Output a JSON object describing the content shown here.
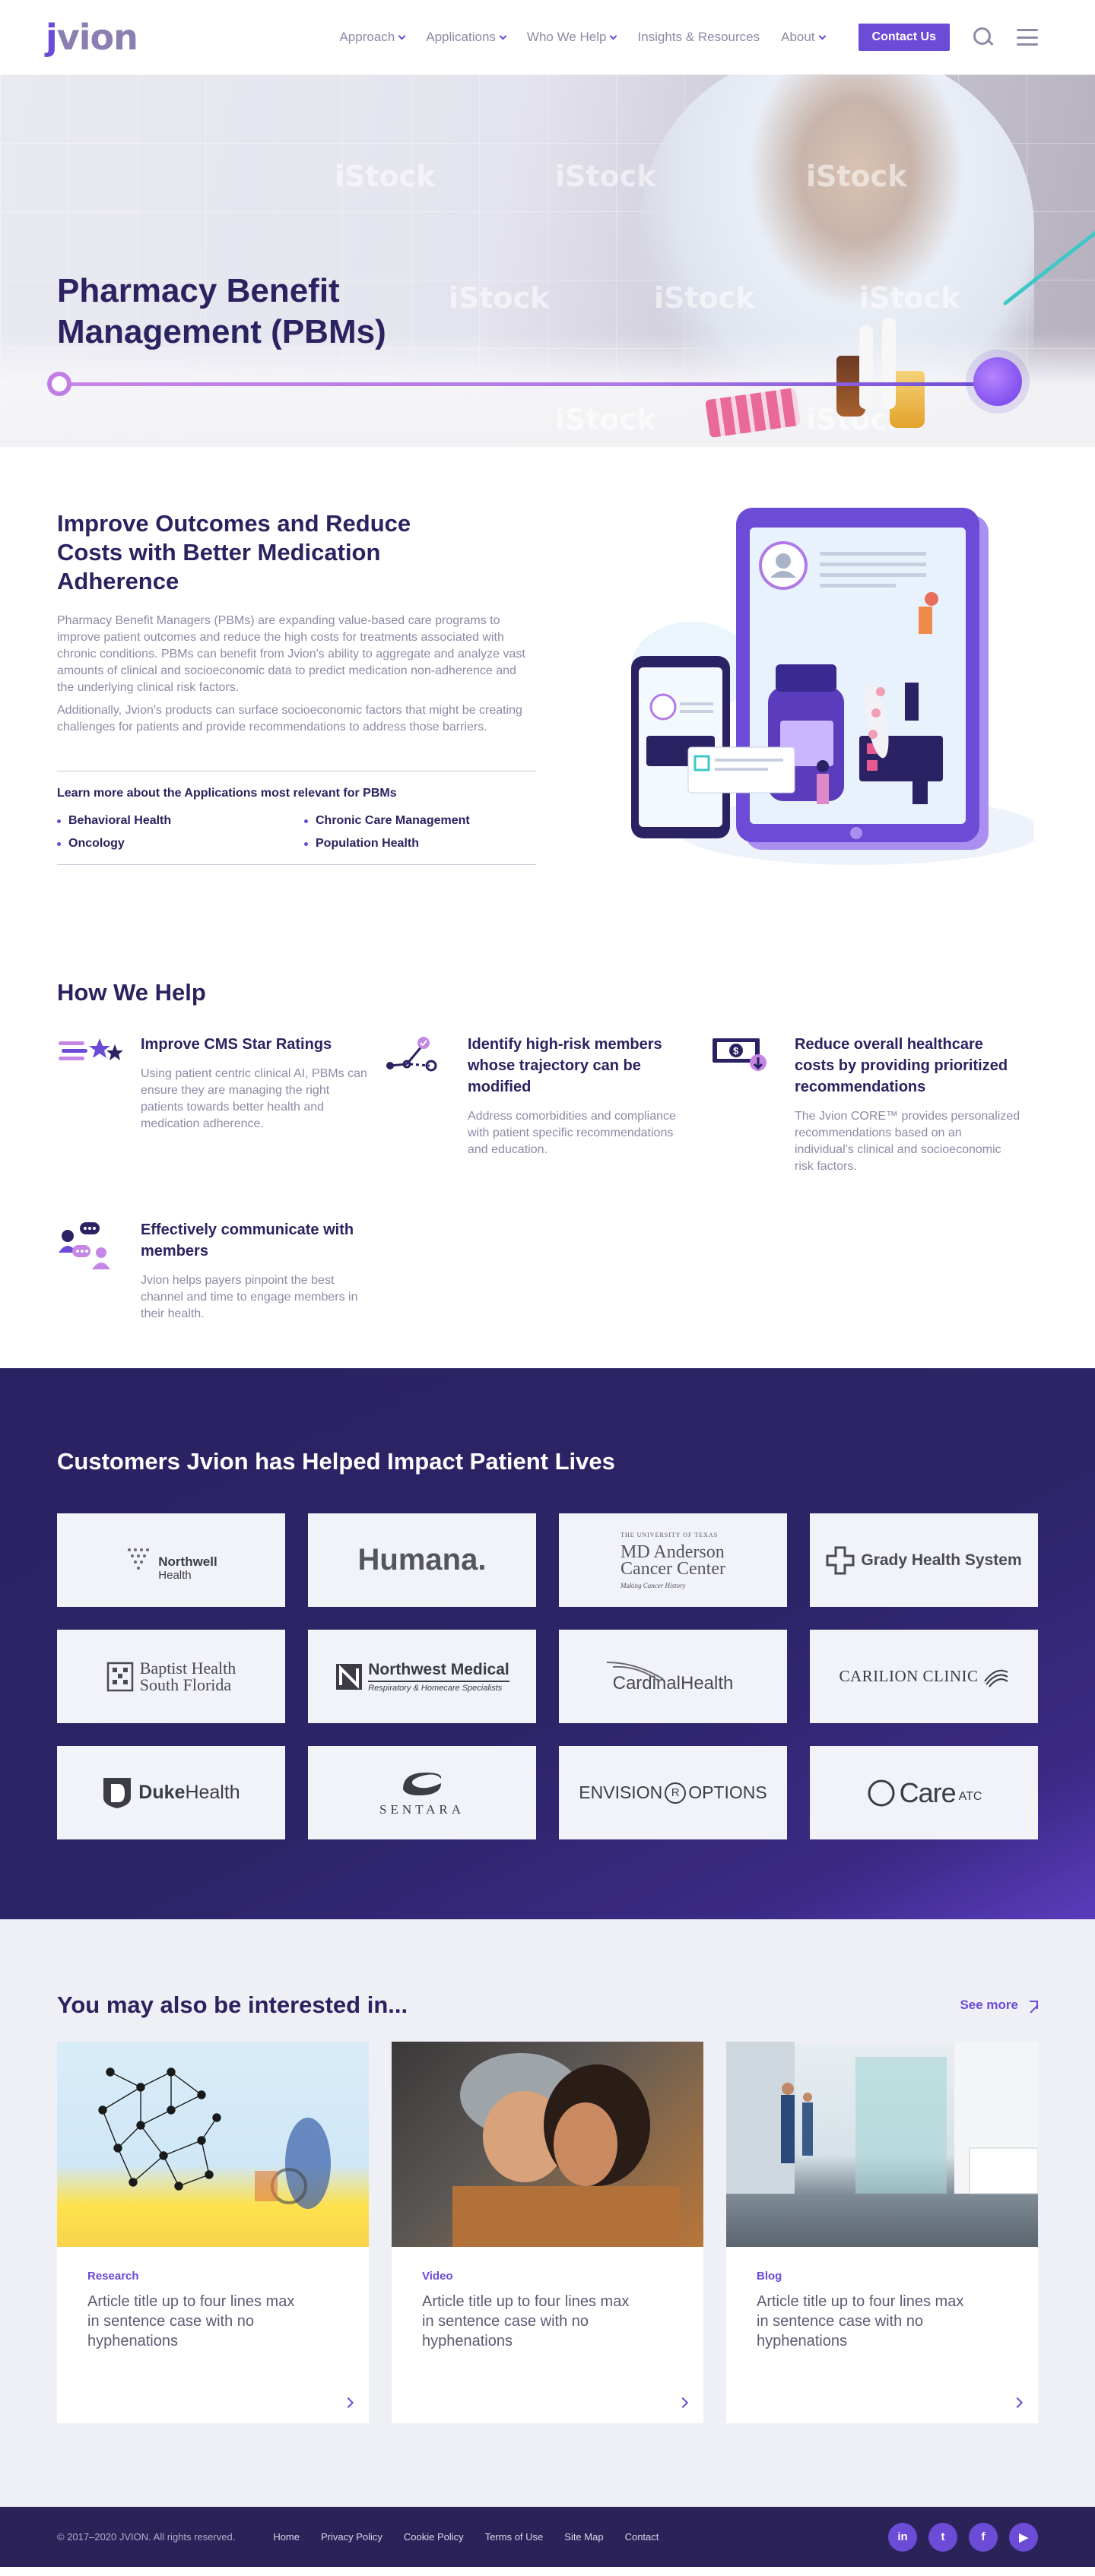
{
  "header": {
    "logo_prefix": "j",
    "logo_rest": "vion",
    "nav": [
      {
        "label": "Approach",
        "has_dropdown": true
      },
      {
        "label": "Applications",
        "has_dropdown": true
      },
      {
        "label": "Who We Help",
        "has_dropdown": true
      },
      {
        "label": "Insights & Resources",
        "has_dropdown": false
      },
      {
        "label": "About",
        "has_dropdown": true
      }
    ],
    "contact_label": "Contact Us",
    "icons": [
      "search-icon",
      "menu-icon"
    ]
  },
  "hero": {
    "title_line1": "Pharmacy Benefit",
    "title_line2": "Management (PBMs)",
    "watermark": "iStock"
  },
  "intro": {
    "title": "Improve Outcomes and Reduce Costs with Better Medication Adherence",
    "paragraph1": "Pharmacy Benefit Managers (PBMs) are expanding value-based care programs to improve patient outcomes and reduce the high costs for treatments associated with chronic conditions. PBMs can benefit from Jvion's ability to aggregate and analyze vast amounts of clinical and socioeconomic data to predict medication non-adherence and the underlying clinical risk factors.",
    "paragraph2": "Additionally, Jvion's products can surface socioeconomic factors that might be creating challenges for patients and provide recommendations to address those barriers.",
    "apps_heading": "Learn more about the Applications most relevant for PBMs",
    "apps": [
      "Behavioral Health",
      "Chronic Care Management",
      "Oncology",
      "Population Health"
    ]
  },
  "help": {
    "title": "How We Help",
    "items": [
      {
        "heading": "Improve CMS Star Ratings",
        "text": "Using patient centric clinical AI, PBMs can ensure they are managing the right patients towards better health and medication adherence.",
        "icon": "stars-icon"
      },
      {
        "heading": "Identify high-risk members whose trajectory can be modified",
        "text": "Address comorbidities and compliance with patient specific recommendations and education.",
        "icon": "trajectory-icon"
      },
      {
        "heading": "Reduce overall healthcare costs by providing prioritized recommendations",
        "text": "The Jvion CORE™ provides personalized recommendations based on an individual's clinical and socioeconomic risk factors.",
        "icon": "dollar-bill-icon"
      },
      {
        "heading": "Effectively communicate with members",
        "text": "Jvion helps payers pinpoint the best channel and time to engage members in their health.",
        "icon": "chat-people-icon"
      }
    ]
  },
  "customers": {
    "title": "Customers Jvion has Helped Impact Patient Lives",
    "logos": [
      {
        "name": "Northwell Health",
        "line1": "Northwell",
        "line2": "Health"
      },
      {
        "name": "Humana",
        "line1": "Humana."
      },
      {
        "name": "MD Anderson Cancer Center",
        "line1": "THE UNIVERSITY OF TEXAS",
        "line2": "MD Anderson",
        "line3": "Cancer Center",
        "line4": "Making Cancer History"
      },
      {
        "name": "Grady Health System",
        "line1": "Grady Health System"
      },
      {
        "name": "Baptist Health South Florida",
        "line1": "Baptist Health",
        "line2": "South Florida"
      },
      {
        "name": "Northwest Medical",
        "line1": "Northwest Medical",
        "line2": "Respiratory & Homecare Specialists"
      },
      {
        "name": "Cardinal Health",
        "line1": "Cardinal",
        "line2": "Health"
      },
      {
        "name": "Carilion Clinic",
        "line1": "CARILION CLINIC"
      },
      {
        "name": "Duke Health",
        "line1": "Duke",
        "line2": "Health"
      },
      {
        "name": "Sentara",
        "line1": "SENTARA"
      },
      {
        "name": "Envision Options",
        "line1": "ENVISION",
        "line2": "R",
        "line3": "OPTIONS"
      },
      {
        "name": "CareATC",
        "line1": "Care",
        "line2": "ATC"
      }
    ]
  },
  "interest": {
    "title": "You may also be interested in...",
    "see_more": "See more",
    "cards": [
      {
        "tag": "Research",
        "title": "Article title up to four lines max in sentence case with no hyphenations"
      },
      {
        "tag": "Video",
        "title": "Article title up to four lines max in sentence case with no hyphenations"
      },
      {
        "tag": "Blog",
        "title": "Article title up to four lines max in sentence case with no hyphenations"
      }
    ]
  },
  "footer": {
    "copyright": "© 2017–2020 JVION. All rights reserved.",
    "links": [
      "Home",
      "Privacy Policy",
      "Cookie Policy",
      "Terms of Use",
      "Site Map",
      "Contact"
    ],
    "social": [
      {
        "label": "in",
        "name": "linkedin-icon"
      },
      {
        "label": "t",
        "name": "twitter-icon"
      },
      {
        "label": "f",
        "name": "facebook-icon"
      },
      {
        "label": "▶",
        "name": "youtube-icon"
      }
    ]
  },
  "colors": {
    "brand_purple": "#6c4bd6",
    "navy": "#2b2260",
    "muted_text": "#8d8aa6",
    "customers_bg": "#2b2263",
    "interest_bg": "#efeff6",
    "footer_bg": "#2a2259"
  }
}
